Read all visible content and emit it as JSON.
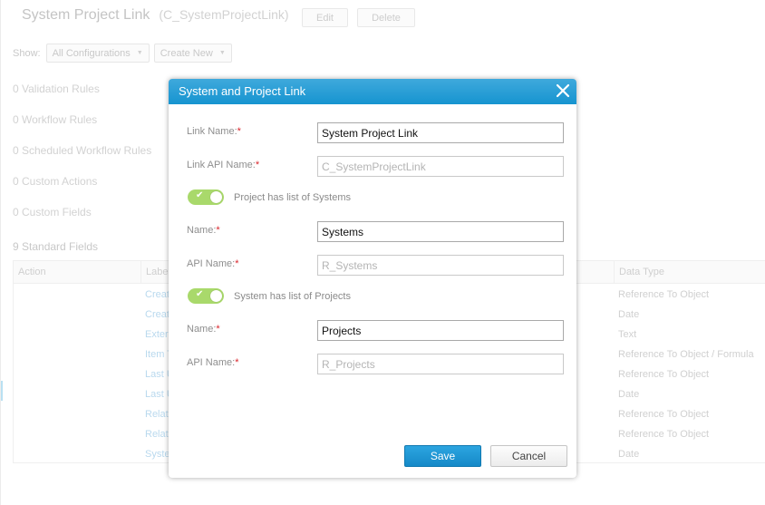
{
  "page": {
    "title": "System Project Link",
    "api_name": "(C_SystemProjectLink)",
    "edit_label": "Edit",
    "delete_label": "Delete",
    "show_label": "Show:",
    "show_filter": "All Configurations",
    "create_new": "Create New",
    "summary": [
      "0 Validation Rules",
      "0 Workflow Rules",
      "0 Scheduled Workflow Rules",
      "0 Custom Actions",
      "0 Custom Fields"
    ],
    "standard_fields_title": "9 Standard Fields",
    "table": {
      "headers": [
        "Action",
        "Label",
        "Data Type"
      ],
      "rows": [
        {
          "label": "Created By",
          "type": "Reference To Object"
        },
        {
          "label": "Created Date",
          "type": "Date"
        },
        {
          "label": "External Id",
          "type": "Text"
        },
        {
          "label": "Item Type",
          "type": "Reference To Object / Formula"
        },
        {
          "label": "Last Updated By",
          "type": "Reference To Object"
        },
        {
          "label": "Last Updated Date",
          "type": "Date"
        },
        {
          "label": "Related Project",
          "type": "Reference To Object"
        },
        {
          "label": "Related System",
          "type": "Reference To Object"
        },
        {
          "label": "System Date",
          "type": "Date"
        }
      ]
    }
  },
  "modal": {
    "title": "System and Project Link",
    "required_mark": "*",
    "link_name_label": "Link Name:",
    "link_name_value": "System Project Link",
    "link_api_label": "Link API Name:",
    "link_api_value": "C_SystemProjectLink",
    "toggle1_label": "Project has list of Systems",
    "toggle1_on": true,
    "name1_label": "Name:",
    "name1_value": "Systems",
    "api1_label": "API Name:",
    "api1_value": "R_Systems",
    "toggle2_label": "System has list of Projects",
    "toggle2_on": true,
    "name2_label": "Name:",
    "name2_value": "Projects",
    "api2_label": "API Name:",
    "api2_value": "R_Projects",
    "save_label": "Save",
    "cancel_label": "Cancel",
    "check_glyph": "✔"
  },
  "colors": {
    "header_blue": "#1694d0",
    "toggle_green": "#a9d96b",
    "required_red": "#d9262c"
  }
}
